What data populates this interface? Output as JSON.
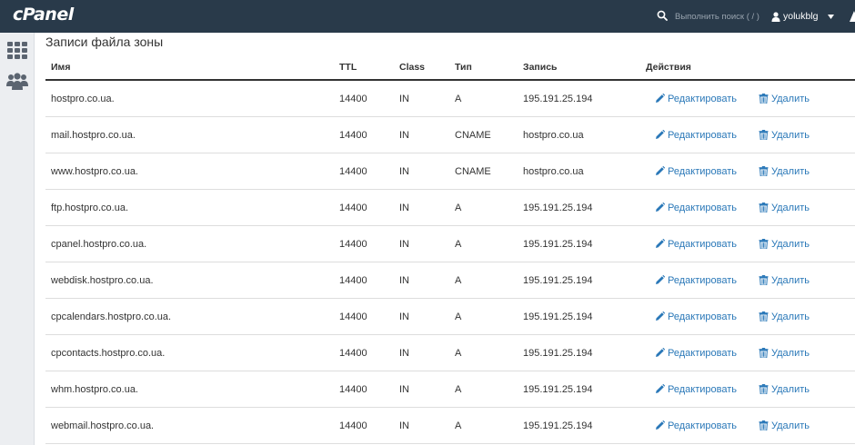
{
  "app": {
    "logo": "cPanel"
  },
  "search": {
    "placeholder": "Выполнить поиск ( / )"
  },
  "user": {
    "name": "yolukblg"
  },
  "page": {
    "title": "Записи файла зоны"
  },
  "table": {
    "headers": {
      "name": "Имя",
      "ttl": "TTL",
      "class": "Class",
      "type": "Тип",
      "record": "Запись",
      "actions": "Действия"
    },
    "edit_label": "Редактировать",
    "delete_label": "Удалить",
    "rows": [
      {
        "name": "hostpro.co.ua.",
        "ttl": "14400",
        "class": "IN",
        "type": "A",
        "record": "195.191.25.194"
      },
      {
        "name": "mail.hostpro.co.ua.",
        "ttl": "14400",
        "class": "IN",
        "type": "CNAME",
        "record": "hostpro.co.ua"
      },
      {
        "name": "www.hostpro.co.ua.",
        "ttl": "14400",
        "class": "IN",
        "type": "CNAME",
        "record": "hostpro.co.ua"
      },
      {
        "name": "ftp.hostpro.co.ua.",
        "ttl": "14400",
        "class": "IN",
        "type": "A",
        "record": "195.191.25.194"
      },
      {
        "name": "cpanel.hostpro.co.ua.",
        "ttl": "14400",
        "class": "IN",
        "type": "A",
        "record": "195.191.25.194"
      },
      {
        "name": "webdisk.hostpro.co.ua.",
        "ttl": "14400",
        "class": "IN",
        "type": "A",
        "record": "195.191.25.194"
      },
      {
        "name": "cpcalendars.hostpro.co.ua.",
        "ttl": "14400",
        "class": "IN",
        "type": "A",
        "record": "195.191.25.194"
      },
      {
        "name": "cpcontacts.hostpro.co.ua.",
        "ttl": "14400",
        "class": "IN",
        "type": "A",
        "record": "195.191.25.194"
      },
      {
        "name": "whm.hostpro.co.ua.",
        "ttl": "14400",
        "class": "IN",
        "type": "A",
        "record": "195.191.25.194"
      },
      {
        "name": "webmail.hostpro.co.ua.",
        "ttl": "14400",
        "class": "IN",
        "type": "A",
        "record": "195.191.25.194"
      }
    ]
  },
  "icons": {
    "search": "search-icon",
    "user": "user-icon",
    "apps": "grid-icon",
    "users": "users-icon",
    "edit": "pencil-icon",
    "delete": "trash-icon"
  },
  "colors": {
    "topbar": "#293a4a",
    "link": "#2a78b8"
  }
}
